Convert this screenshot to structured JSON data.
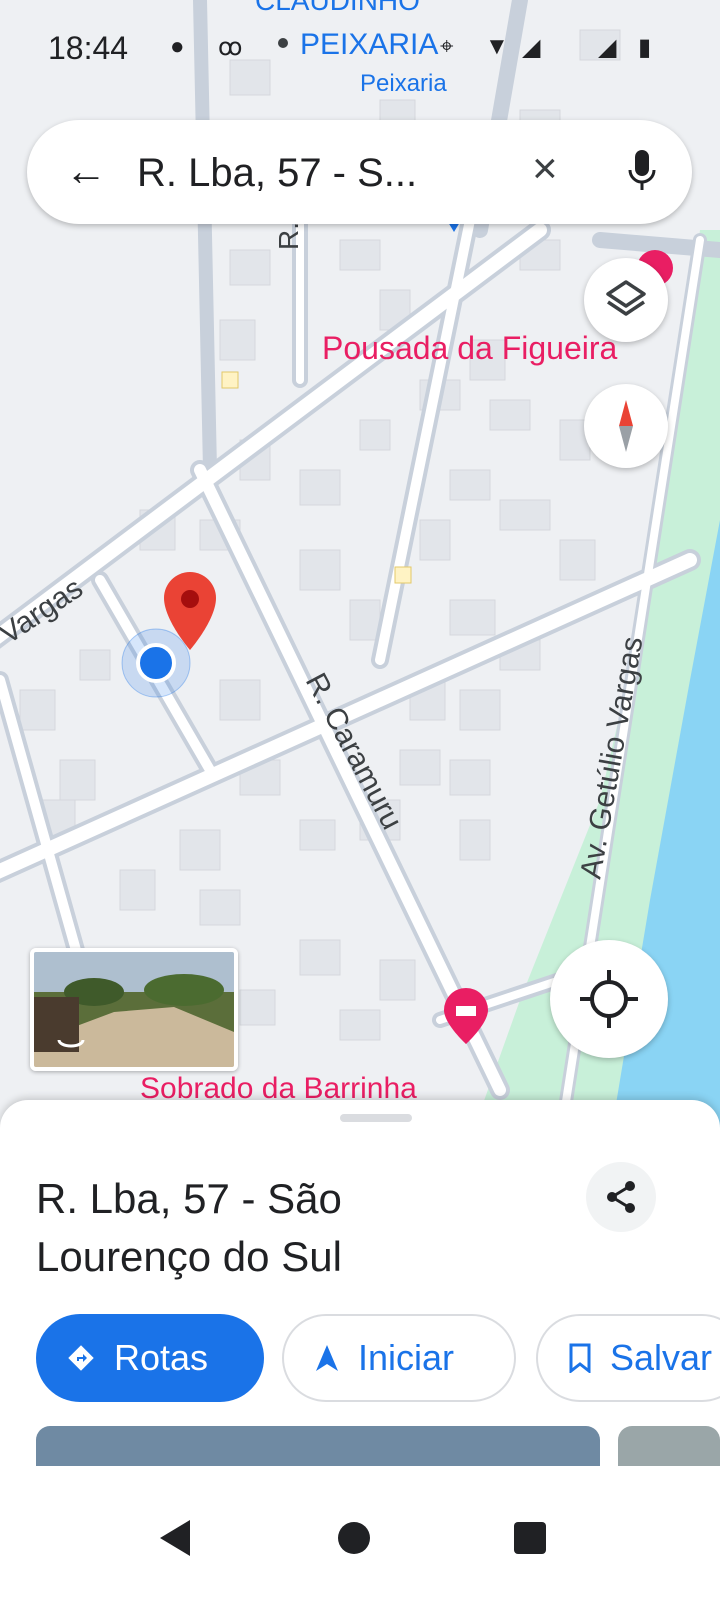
{
  "status_bar": {
    "time": "18:44",
    "icons": [
      "messenger-icon",
      "voicemail-icon",
      "location-icon",
      "wifi-icon",
      "signal-icon",
      "signal-icon",
      "battery-icon"
    ]
  },
  "map": {
    "labels": {
      "top_street_cut": "CLAUDINHO",
      "peixaria": "PEIXARIA",
      "peixaria_sub": "Peixaria",
      "street_r_top": "R.",
      "pousada": "Pousada da Figueira",
      "vargas_left": "Vargas",
      "caramuru": "R. Caramuru",
      "getulio": "Av. Getúlio Vargas",
      "sobrado": "Sobrado da Barrinha"
    },
    "colors": {
      "pin": "#ea4335",
      "location_dot": "#1a73e8",
      "poi_pink": "#e91e63",
      "poi_blue": "#1a73e8",
      "water": "#8ad4f4",
      "park": "#c8f0d9"
    }
  },
  "search": {
    "query": "R. Lba, 57 - S...",
    "back_icon": "back-arrow-icon",
    "clear_icon": "close-icon",
    "mic_icon": "mic-icon"
  },
  "place": {
    "address_line1": "R. Lba, 57 - São",
    "address_line2": "Lourenço do Sul",
    "actions": {
      "directions": "Rotas",
      "start": "Iniciar",
      "save": "Salvar"
    }
  }
}
